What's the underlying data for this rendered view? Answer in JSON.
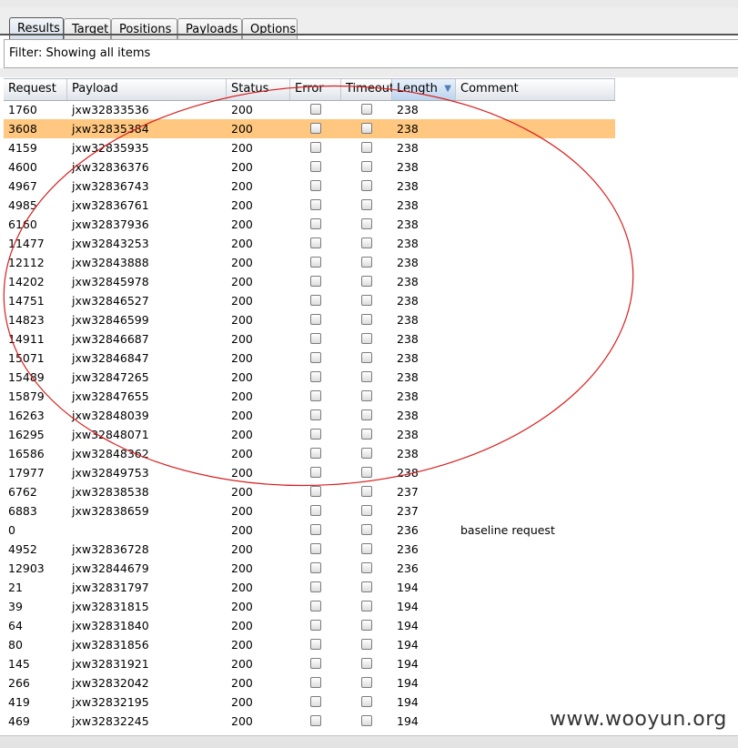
{
  "tabs": [
    {
      "label": "Results"
    },
    {
      "label": "Target"
    },
    {
      "label": "Positions"
    },
    {
      "label": "Payloads"
    },
    {
      "label": "Options"
    }
  ],
  "filter": {
    "text": "Filter: Showing all items"
  },
  "columns": [
    "Request",
    "Payload",
    "Status",
    "Error",
    "Timeout",
    "Length",
    "Comment"
  ],
  "sorted_column": "Length",
  "rows": [
    {
      "request": "1760",
      "payload": "jxw32833536",
      "status": "200",
      "length": "238",
      "comment": "",
      "selected": false
    },
    {
      "request": "3608",
      "payload": "jxw32835384",
      "status": "200",
      "length": "238",
      "comment": "",
      "selected": true
    },
    {
      "request": "4159",
      "payload": "jxw32835935",
      "status": "200",
      "length": "238",
      "comment": "",
      "selected": false
    },
    {
      "request": "4600",
      "payload": "jxw32836376",
      "status": "200",
      "length": "238",
      "comment": "",
      "selected": false
    },
    {
      "request": "4967",
      "payload": "jxw32836743",
      "status": "200",
      "length": "238",
      "comment": "",
      "selected": false
    },
    {
      "request": "4985",
      "payload": "jxw32836761",
      "status": "200",
      "length": "238",
      "comment": "",
      "selected": false
    },
    {
      "request": "6160",
      "payload": "jxw32837936",
      "status": "200",
      "length": "238",
      "comment": "",
      "selected": false
    },
    {
      "request": "11477",
      "payload": "jxw32843253",
      "status": "200",
      "length": "238",
      "comment": "",
      "selected": false
    },
    {
      "request": "12112",
      "payload": "jxw32843888",
      "status": "200",
      "length": "238",
      "comment": "",
      "selected": false
    },
    {
      "request": "14202",
      "payload": "jxw32845978",
      "status": "200",
      "length": "238",
      "comment": "",
      "selected": false
    },
    {
      "request": "14751",
      "payload": "jxw32846527",
      "status": "200",
      "length": "238",
      "comment": "",
      "selected": false
    },
    {
      "request": "14823",
      "payload": "jxw32846599",
      "status": "200",
      "length": "238",
      "comment": "",
      "selected": false
    },
    {
      "request": "14911",
      "payload": "jxw32846687",
      "status": "200",
      "length": "238",
      "comment": "",
      "selected": false
    },
    {
      "request": "15071",
      "payload": "jxw32846847",
      "status": "200",
      "length": "238",
      "comment": "",
      "selected": false
    },
    {
      "request": "15489",
      "payload": "jxw32847265",
      "status": "200",
      "length": "238",
      "comment": "",
      "selected": false
    },
    {
      "request": "15879",
      "payload": "jxw32847655",
      "status": "200",
      "length": "238",
      "comment": "",
      "selected": false
    },
    {
      "request": "16263",
      "payload": "jxw32848039",
      "status": "200",
      "length": "238",
      "comment": "",
      "selected": false
    },
    {
      "request": "16295",
      "payload": "jxw32848071",
      "status": "200",
      "length": "238",
      "comment": "",
      "selected": false
    },
    {
      "request": "16586",
      "payload": "jxw32848362",
      "status": "200",
      "length": "238",
      "comment": "",
      "selected": false
    },
    {
      "request": "17977",
      "payload": "jxw32849753",
      "status": "200",
      "length": "238",
      "comment": "",
      "selected": false
    },
    {
      "request": "6762",
      "payload": "jxw32838538",
      "status": "200",
      "length": "237",
      "comment": "",
      "selected": false
    },
    {
      "request": "6883",
      "payload": "jxw32838659",
      "status": "200",
      "length": "237",
      "comment": "",
      "selected": false
    },
    {
      "request": "0",
      "payload": "",
      "status": "200",
      "length": "236",
      "comment": "baseline request",
      "selected": false
    },
    {
      "request": "4952",
      "payload": "jxw32836728",
      "status": "200",
      "length": "236",
      "comment": "",
      "selected": false
    },
    {
      "request": "12903",
      "payload": "jxw32844679",
      "status": "200",
      "length": "236",
      "comment": "",
      "selected": false
    },
    {
      "request": "21",
      "payload": "jxw32831797",
      "status": "200",
      "length": "194",
      "comment": "",
      "selected": false
    },
    {
      "request": "39",
      "payload": "jxw32831815",
      "status": "200",
      "length": "194",
      "comment": "",
      "selected": false
    },
    {
      "request": "64",
      "payload": "jxw32831840",
      "status": "200",
      "length": "194",
      "comment": "",
      "selected": false
    },
    {
      "request": "80",
      "payload": "jxw32831856",
      "status": "200",
      "length": "194",
      "comment": "",
      "selected": false
    },
    {
      "request": "145",
      "payload": "jxw32831921",
      "status": "200",
      "length": "194",
      "comment": "",
      "selected": false
    },
    {
      "request": "266",
      "payload": "jxw32832042",
      "status": "200",
      "length": "194",
      "comment": "",
      "selected": false
    },
    {
      "request": "419",
      "payload": "jxw32832195",
      "status": "200",
      "length": "194",
      "comment": "",
      "selected": false
    },
    {
      "request": "469",
      "payload": "jxw32832245",
      "status": "200",
      "length": "194",
      "comment": "",
      "selected": false
    }
  ],
  "annotation_color": "#d81e1e",
  "selected_row_color": "#ffc77f",
  "watermark": "www.wooyun.org"
}
